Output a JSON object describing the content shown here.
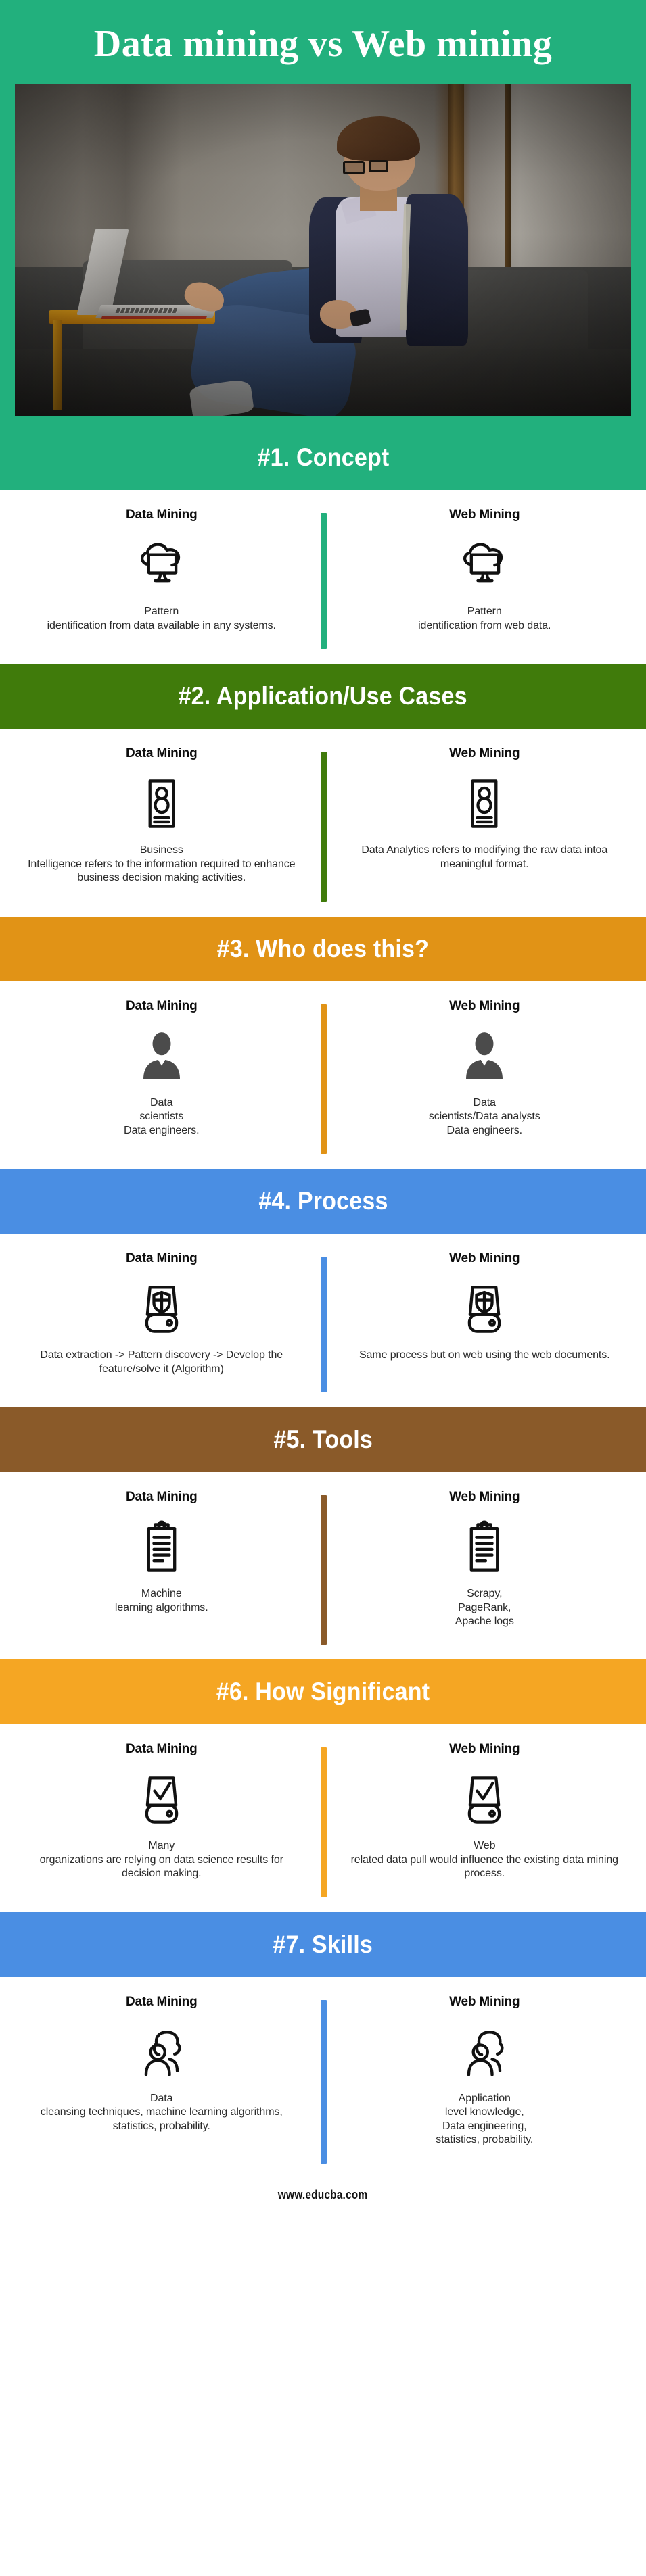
{
  "hero": {
    "title": "Data mining vs Web mining",
    "background_color": "#22b07d",
    "photo_alt": "Man with glasses sitting on a dark couch typing on a laptop placed on a yellow side table"
  },
  "footer": {
    "url": "www.educba.com"
  },
  "column_labels": {
    "left": "Data Mining",
    "right": "Web Mining"
  },
  "sections": [
    {
      "id": "concept",
      "heading": "#1. Concept",
      "color": "#22b07d",
      "icon": "cloud-monitor-icon",
      "left": {
        "title": "Data Mining",
        "desc": "Pattern\nidentification from data available in any systems."
      },
      "right": {
        "title": "Web Mining",
        "desc": "Pattern\nidentification from web data."
      }
    },
    {
      "id": "application-use-cases",
      "heading": "#2. Application/Use Cases",
      "color": "#407b0b",
      "icon": "person-document-icon",
      "left": {
        "title": "Data Mining",
        "desc": "Business\nIntelligence refers to the information required to enhance business decision making activities."
      },
      "right": {
        "title": "Web Mining",
        "desc": "Data Analytics refers to modifying the raw data intoa meaningful format."
      }
    },
    {
      "id": "who-does-this",
      "heading": "#3. Who does this?",
      "color": "#e19316",
      "icon": "user-avatar-icon",
      "left": {
        "title": "Data Mining",
        "desc": "Data\nscientists\nData engineers."
      },
      "right": {
        "title": "Web Mining",
        "desc": "Data\nscientists/Data analysts\nData engineers."
      }
    },
    {
      "id": "process",
      "heading": "#4. Process",
      "color": "#4a8ee3",
      "icon": "shield-drive-icon",
      "left": {
        "title": "Data Mining",
        "desc": "Data extraction -> Pattern discovery -> Develop the feature/solve it (Algorithm)"
      },
      "right": {
        "title": "Web Mining",
        "desc": "Same process but on web using the web documents."
      }
    },
    {
      "id": "tools",
      "heading": "#5. Tools",
      "color": "#8a5a29",
      "icon": "clipboard-icon",
      "left": {
        "title": "Data Mining",
        "desc": "Machine\nlearning algorithms."
      },
      "right": {
        "title": "Web Mining",
        "desc": "Scrapy,\nPageRank,\nApache logs"
      }
    },
    {
      "id": "how-significant",
      "heading": "#6. How Significant",
      "color": "#f5a623",
      "icon": "check-drive-icon",
      "left": {
        "title": "Data Mining",
        "desc": "Many\norganizations are relying on data science results for decision making."
      },
      "right": {
        "title": "Web Mining",
        "desc": "Web\nrelated data pull would influence the existing data mining process."
      }
    },
    {
      "id": "skills",
      "heading": "#7. Skills",
      "color": "#4a8ee3",
      "icon": "people-group-icon",
      "left": {
        "title": "Data Mining",
        "desc": "Data\ncleansing techniques, machine learning algorithms, statistics, probability."
      },
      "right": {
        "title": "Web Mining",
        "desc": "Application\nlevel knowledge,\nData engineering,\nstatistics, probability."
      }
    }
  ]
}
